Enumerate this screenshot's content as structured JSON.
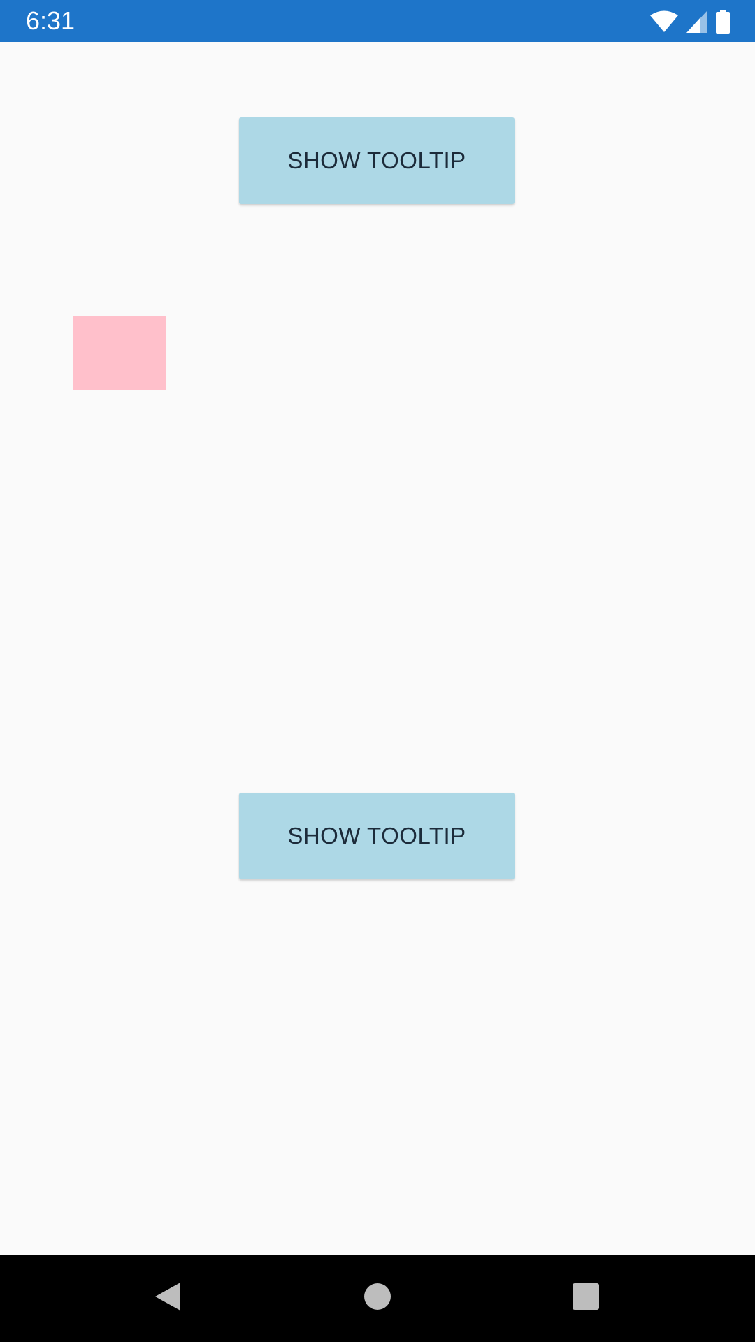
{
  "status_bar": {
    "time": "6:31",
    "icons": [
      "wifi-icon",
      "cell-signal-icon",
      "battery-icon"
    ],
    "background_color": "#1e75c9"
  },
  "main": {
    "buttons": [
      {
        "label": "SHOW TOOLTIP"
      },
      {
        "label": "SHOW TOOLTIP"
      }
    ],
    "button_color": "#add8e6",
    "box_color": "#ffc0cb"
  },
  "nav_bar": {
    "icons": [
      "back-icon",
      "home-icon",
      "recents-icon"
    ]
  }
}
